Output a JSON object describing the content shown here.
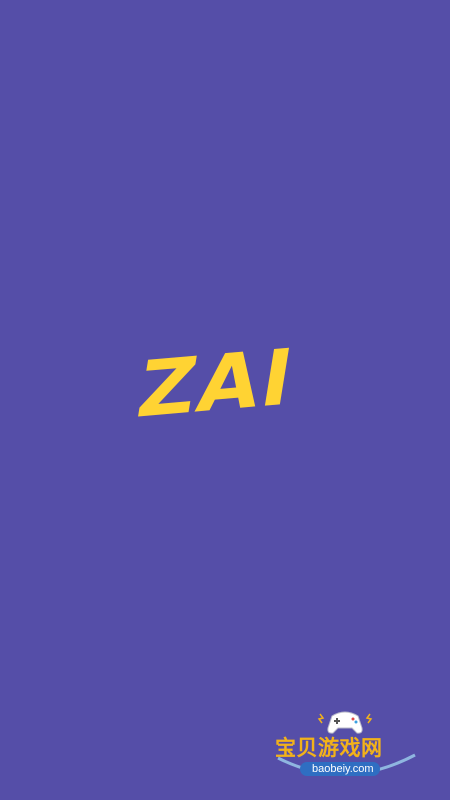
{
  "app": {
    "logo_text": "ZAI",
    "background_color": "#554ea8",
    "logo_color": "#ffd333"
  },
  "watermark": {
    "icon": "game-controller-icon",
    "title": "宝贝游戏网",
    "domain": "baobeiy.com",
    "title_color": "#f2b21a"
  }
}
